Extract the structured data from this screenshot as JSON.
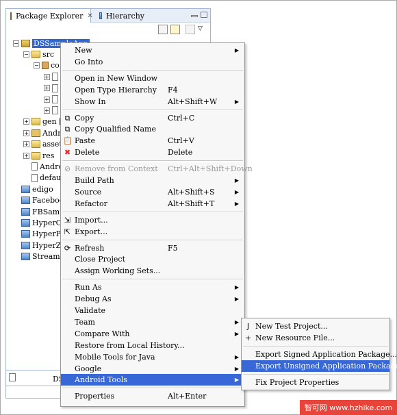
{
  "view": {
    "tabs": [
      {
        "label": "Package Explorer",
        "close": "✕"
      },
      {
        "label": "Hierarchy"
      }
    ]
  },
  "tree": [
    {
      "label": "DSSampleApp",
      "level": 0,
      "exp": "−",
      "icon": "project-icon",
      "selected": true
    },
    {
      "label": "src",
      "level": 1,
      "exp": "−",
      "icon": "folder-icon"
    },
    {
      "label": "co",
      "level": 2,
      "exp": "−",
      "icon": "package-icon"
    },
    {
      "label": "",
      "level": 3,
      "exp": "+",
      "icon": "java-file-icon"
    },
    {
      "label": "",
      "level": 3,
      "exp": "+",
      "icon": "java-file-icon"
    },
    {
      "label": "",
      "level": 3,
      "exp": "+",
      "icon": "java-file-icon"
    },
    {
      "label": "",
      "level": 3,
      "exp": "+",
      "icon": "java-file-icon"
    },
    {
      "label": "gen [G",
      "level": 1,
      "exp": "+",
      "icon": "folder-icon"
    },
    {
      "label": "Andro",
      "level": 1,
      "exp": "+",
      "icon": "android-icon"
    },
    {
      "label": "asset",
      "level": 1,
      "exp": "+",
      "icon": "folder-icon"
    },
    {
      "label": "res",
      "level": 1,
      "exp": "+",
      "icon": "folder-icon"
    },
    {
      "label": "Andro",
      "level": 1,
      "exp": "",
      "icon": "file-icon"
    },
    {
      "label": "defau",
      "level": 1,
      "exp": "",
      "icon": "file-icon"
    },
    {
      "label": "edigo",
      "level": 0,
      "exp": "",
      "icon": "closed-project-icon"
    },
    {
      "label": "Faceboo",
      "level": 0,
      "exp": "",
      "icon": "closed-project-icon"
    },
    {
      "label": "FBSampl",
      "level": 0,
      "exp": "",
      "icon": "closed-project-icon"
    },
    {
      "label": "HyperCa",
      "level": 0,
      "exp": "",
      "icon": "closed-project-icon"
    },
    {
      "label": "HyperPla",
      "level": 0,
      "exp": "",
      "icon": "closed-project-icon"
    },
    {
      "label": "HyperZo",
      "level": 0,
      "exp": "",
      "icon": "closed-project-icon"
    },
    {
      "label": "StreamF",
      "level": 0,
      "exp": "",
      "icon": "closed-project-icon"
    }
  ],
  "bottom_panel": {
    "label": "DS"
  },
  "menu": [
    {
      "label": "New",
      "arrow": "▶"
    },
    {
      "label": "Go Into"
    },
    {
      "sep": true
    },
    {
      "label": "Open in New Window"
    },
    {
      "label": "Open Type Hierarchy",
      "acc": "F4"
    },
    {
      "label": "Show In",
      "acc": "Alt+Shift+W",
      "arrow": "▶"
    },
    {
      "sep": true
    },
    {
      "label": "Copy",
      "acc": "Ctrl+C",
      "icon": "copy-icon",
      "glyph": "⧉"
    },
    {
      "label": "Copy Qualified Name",
      "icon": "copy-qualified-icon",
      "glyph": "⧉"
    },
    {
      "label": "Paste",
      "acc": "Ctrl+V",
      "icon": "paste-icon",
      "glyph": "📋"
    },
    {
      "label": "Delete",
      "acc": "Delete",
      "icon": "delete-icon",
      "glyph": "✖",
      "glyph_color": "#d22"
    },
    {
      "sep": true
    },
    {
      "label": "Remove from Context",
      "acc": "Ctrl+Alt+Shift+Down",
      "disabled": true,
      "icon": "remove-context-icon",
      "glyph": "⊘"
    },
    {
      "label": "Build Path",
      "arrow": "▶"
    },
    {
      "label": "Source",
      "acc": "Alt+Shift+S",
      "arrow": "▶"
    },
    {
      "label": "Refactor",
      "acc": "Alt+Shift+T",
      "arrow": "▶"
    },
    {
      "sep": true
    },
    {
      "label": "Import...",
      "icon": "import-icon",
      "glyph": "⇲"
    },
    {
      "label": "Export...",
      "icon": "export-icon",
      "glyph": "⇱"
    },
    {
      "sep": true
    },
    {
      "label": "Refresh",
      "acc": "F5",
      "icon": "refresh-icon",
      "glyph": "⟳"
    },
    {
      "label": "Close Project"
    },
    {
      "label": "Assign Working Sets..."
    },
    {
      "sep": true
    },
    {
      "label": "Run As",
      "arrow": "▶"
    },
    {
      "label": "Debug As",
      "arrow": "▶"
    },
    {
      "label": "Validate"
    },
    {
      "label": "Team",
      "arrow": "▶"
    },
    {
      "label": "Compare With",
      "arrow": "▶"
    },
    {
      "label": "Restore from Local History..."
    },
    {
      "label": "Mobile Tools for Java",
      "arrow": "▶"
    },
    {
      "label": "Google",
      "arrow": "▶"
    },
    {
      "label": "Android Tools",
      "arrow": "▶",
      "highlighted": true
    },
    {
      "sep": true
    },
    {
      "label": "Properties",
      "acc": "Alt+Enter"
    }
  ],
  "submenu": [
    {
      "label": "New Test Project...",
      "icon": "test-project-icon",
      "glyph": "J"
    },
    {
      "label": "New Resource File...",
      "icon": "resource-file-icon",
      "glyph": "+"
    },
    {
      "sep": true
    },
    {
      "label": "Export Signed Application Package..."
    },
    {
      "label": "Export Unsigned Application Package...",
      "highlighted": true
    },
    {
      "sep": true
    },
    {
      "label": "Fix Project Properties"
    }
  ],
  "watermark": "智可网 www.hzhike.com"
}
